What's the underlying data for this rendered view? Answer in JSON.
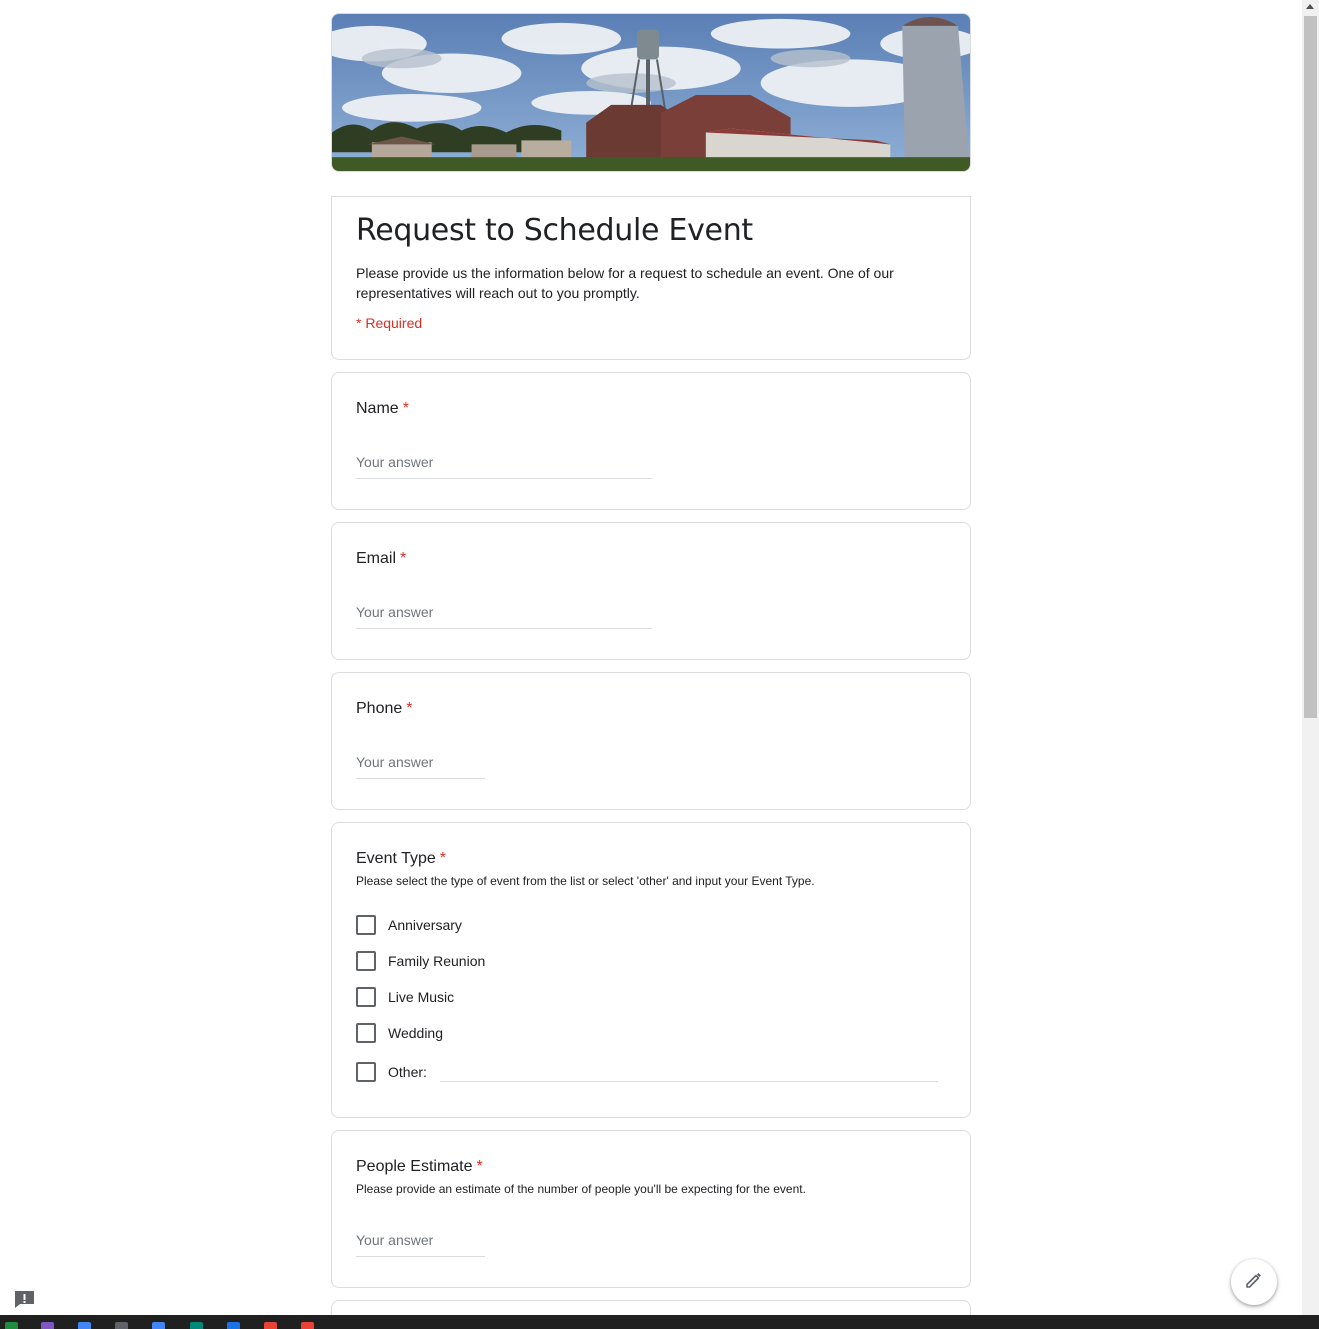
{
  "form": {
    "title": "Request to Schedule Event",
    "description": "Please provide us the information below for a request to schedule an event.  One of our representatives will reach out to you promptly.",
    "required_note": "* Required"
  },
  "questions": {
    "name": {
      "label": "Name",
      "required_mark": "*",
      "placeholder": "Your answer"
    },
    "email": {
      "label": "Email",
      "required_mark": "*",
      "placeholder": "Your answer"
    },
    "phone": {
      "label": "Phone",
      "required_mark": "*",
      "placeholder": "Your answer"
    },
    "event_type": {
      "label": "Event Type",
      "required_mark": "*",
      "help": "Please select the type of event from the list or select 'other' and input your Event Type.",
      "options": [
        "Anniversary",
        "Family Reunion",
        "Live Music",
        "Wedding",
        "Other:"
      ]
    },
    "people_estimate": {
      "label": "People Estimate",
      "required_mark": "*",
      "help": "Please provide an estimate of the number of people you'll be expecting for the event.",
      "placeholder": "Your answer"
    }
  },
  "icons": {
    "edit": "pencil-icon",
    "feedback": "report-feedback-icon"
  },
  "colors": {
    "required": "#d93025",
    "border": "#dadce0",
    "text": "#202124",
    "placeholder": "#70757a"
  }
}
